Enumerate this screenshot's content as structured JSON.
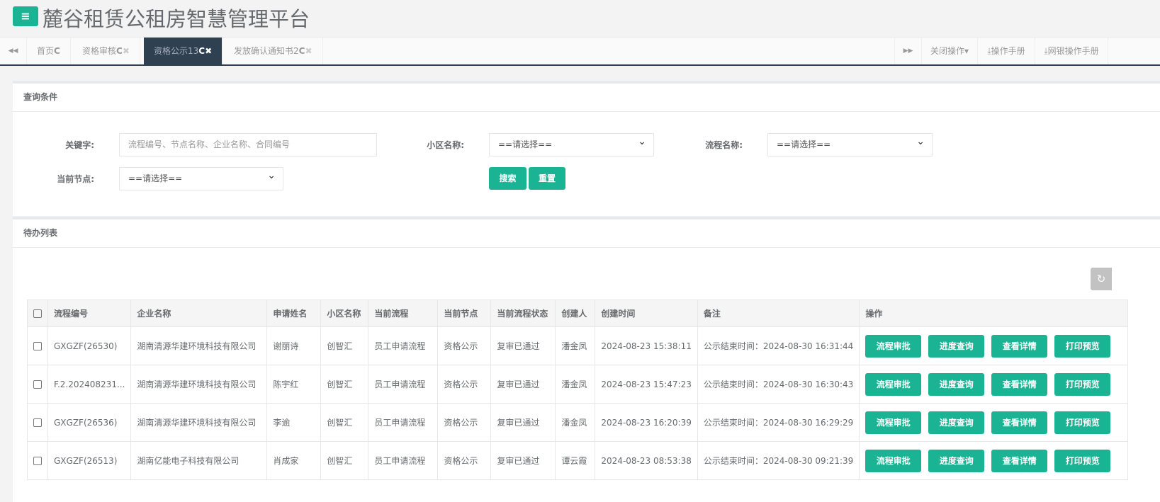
{
  "header": {
    "title": "麓谷租赁公租房智慧管理平台",
    "menu_icon": "≡"
  },
  "tabs": [
    {
      "label": "首页",
      "closable": false
    },
    {
      "label": "资格审核",
      "closable": true
    },
    {
      "label": "资格公示13",
      "closable": true,
      "active": true
    },
    {
      "label": "发放确认通知书2",
      "closable": true
    }
  ],
  "nav": {
    "prev": "◀◀",
    "next": "▶▶",
    "close_ops": "关闭操作▾",
    "manual": "操作手册",
    "bank_manual": "网银操作手册"
  },
  "query": {
    "title": "查询条件",
    "keyword_label": "关键字:",
    "keyword_placeholder": "流程编号、节点名称、企业名称、合同编号",
    "community_label": "小区名称:",
    "community_value": "==请选择==",
    "flow_label": "流程名称:",
    "flow_value": "==请选择==",
    "node_label": "当前节点:",
    "node_value": "==请选择==",
    "search": "搜索",
    "reset": "重置"
  },
  "list": {
    "title": "待办列表",
    "refresh_icon": "↻",
    "columns": [
      "流程编号",
      "企业名称",
      "申请姓名",
      "小区名称",
      "当前流程",
      "当前节点",
      "当前流程状态",
      "创建人",
      "创建时间",
      "备注",
      "操作"
    ],
    "actions": [
      "流程审批",
      "进度查询",
      "查看详情",
      "打印预览"
    ],
    "rows": [
      [
        "GXGZF(26530)",
        "湖南清源华建环境科技有限公司",
        "谢丽诗",
        "创智汇",
        "员工申请流程",
        "资格公示",
        "复审已通过",
        "潘金凤",
        "2024-08-23 15:38:11",
        "公示结束时间：2024-08-30 16:31:44"
      ],
      [
        "F.2.202408231...",
        "湖南清源华建环境科技有限公司",
        "陈宇红",
        "创智汇",
        "员工申请流程",
        "资格公示",
        "复审已通过",
        "潘金凤",
        "2024-08-23 15:47:23",
        "公示结束时间：2024-08-30 16:30:43"
      ],
      [
        "GXGZF(26536)",
        "湖南清源华建环境科技有限公司",
        "李逾",
        "创智汇",
        "员工申请流程",
        "资格公示",
        "复审已通过",
        "潘金凤",
        "2024-08-23 16:20:39",
        "公示结束时间：2024-08-30 16:29:29"
      ],
      [
        "GXGZF(26513)",
        "湖南亿能电子科技有限公司",
        "肖成家",
        "创智汇",
        "员工申请流程",
        "资格公示",
        "复审已通过",
        "谭云霞",
        "2024-08-23 08:53:38",
        "公示结束时间：2024-08-30 09:21:39"
      ]
    ]
  }
}
